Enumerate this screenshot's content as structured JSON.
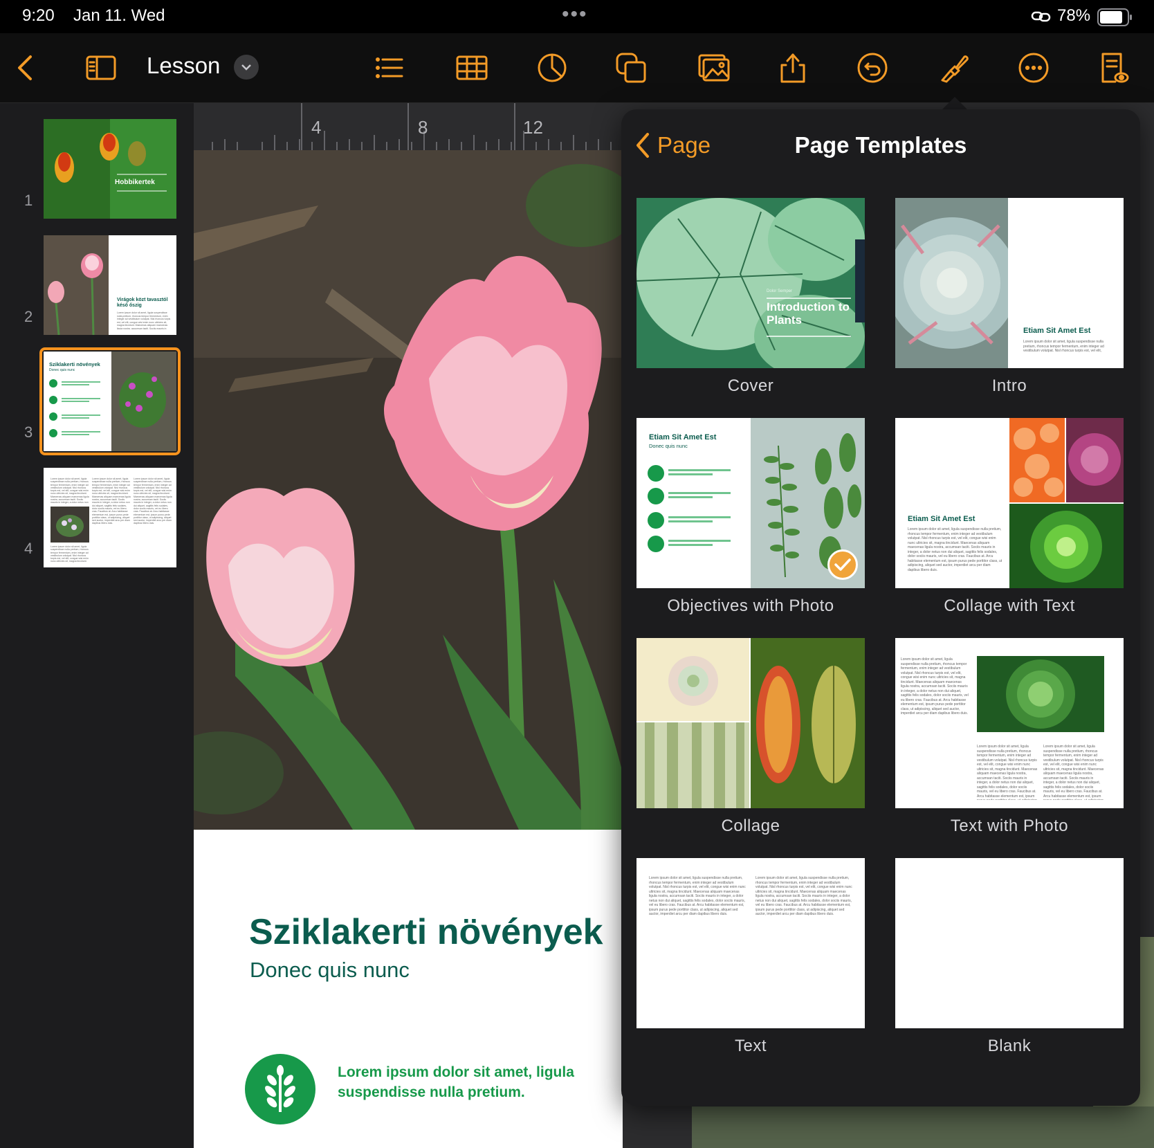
{
  "status": {
    "time": "9:20",
    "date": "Jan 11. Wed",
    "battery": "78%",
    "dots": "•••"
  },
  "toolbar": {
    "title": "Lesson"
  },
  "sidebar": {
    "pages": [
      {
        "num": "1",
        "title": "Hobbikertek"
      },
      {
        "num": "2",
        "title": "Virágok közt tavasztól késő őszig"
      },
      {
        "num": "3",
        "title": "Sziklakerti növények",
        "subtitle": "Donec quis nunc"
      },
      {
        "num": "4"
      }
    ]
  },
  "ruler": {
    "ticks": [
      "4",
      "8",
      "12"
    ]
  },
  "page": {
    "title": "Sziklakerti növények",
    "subtitle": "Donec quis nunc",
    "bullet": "Lorem ipsum dolor sit amet, ligula suspendisse nulla pretium."
  },
  "popover": {
    "back_label": "Page",
    "title": "Page Templates",
    "templates": [
      {
        "label": "Cover",
        "heading": "Introduction to Plants",
        "kicker": "Dolor Semper"
      },
      {
        "label": "Intro",
        "heading": "Etiam Sit Amet Est"
      },
      {
        "label": "Objectives with Photo",
        "heading": "Etiam Sit Amet Est",
        "subheading": "Donec quis nunc",
        "selected": true
      },
      {
        "label": "Collage with Text",
        "heading": "Etiam Sit Amet Est"
      },
      {
        "label": "Collage"
      },
      {
        "label": "Text with Photo"
      },
      {
        "label": "Text"
      },
      {
        "label": "Blank"
      }
    ]
  },
  "colors": {
    "accent": "#f39b27",
    "green": "#17994a",
    "darkgreen": "#0b5c4e"
  },
  "lorem": "Lorem ipsum dolor sit amet, ligula suspendisse nulla pretium, rhoncus tempor fermentum, enim integer ad vestibulum volutpat. Nisl rhoncus turpis est, vel elit, congue wisi enim nunc ultricies sit, magna tincidunt. Maecenas aliquam maecenas ligula nostra, accumsan taciti. Sociis mauris in integer, a dolor netus non dui aliquet, sagittis felis sodales, dolor sociis mauris, vel eu libero cras. Faucibus at. Arcu habitasse elementum est, ipsum purus pede porttitor class, ut adipiscing, aliquet sed auctor, imperdiet arcu per diam dapibus libero duis."
}
